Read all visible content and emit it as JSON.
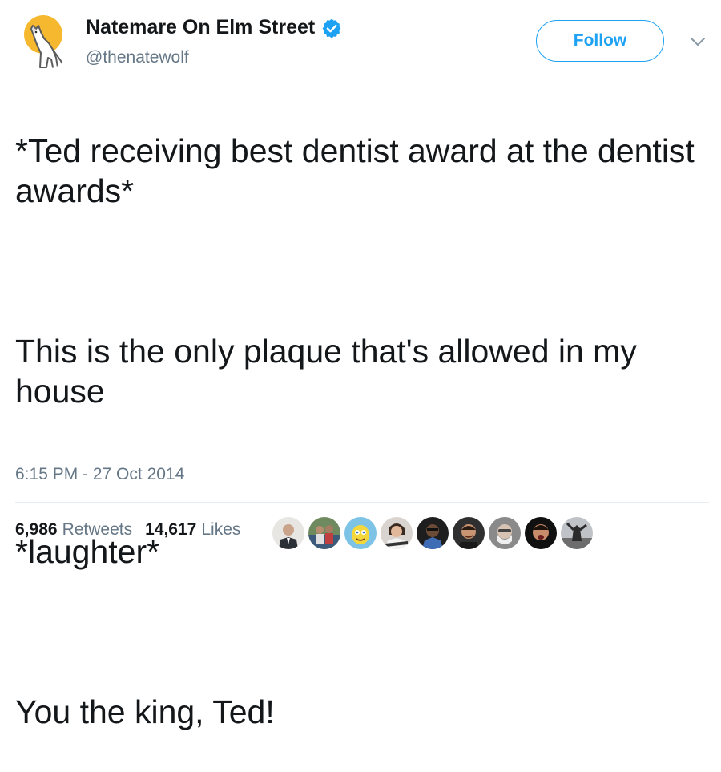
{
  "user": {
    "display_name": "Natemare On Elm Street",
    "handle": "@thenatewolf",
    "avatar_icon": "howling-wolf-moon-icon",
    "verified_icon": "verified-badge-icon",
    "verified_color": "#1da1f2"
  },
  "actions": {
    "follow_label": "Follow",
    "more_icon": "chevron-down-icon"
  },
  "tweet": {
    "paragraphs": [
      "*Ted receiving best dentist award at the dentist awards*",
      "This is the only plaque that's allowed in my house",
      "*laughter*",
      "You the king, Ted!"
    ],
    "timestamp": "6:15 PM - 27 Oct 2014"
  },
  "stats": {
    "retweets_count": "6,986",
    "retweets_label": "Retweets",
    "likes_count": "14,617",
    "likes_label": "Likes"
  },
  "likers": [
    {
      "icon": "liker-avatar-1"
    },
    {
      "icon": "liker-avatar-2"
    },
    {
      "icon": "liker-avatar-3"
    },
    {
      "icon": "liker-avatar-4"
    },
    {
      "icon": "liker-avatar-5"
    },
    {
      "icon": "liker-avatar-6"
    },
    {
      "icon": "liker-avatar-7"
    },
    {
      "icon": "liker-avatar-8"
    },
    {
      "icon": "liker-avatar-9"
    }
  ],
  "colors": {
    "accent": "#1da1f2",
    "text": "#14171a",
    "secondary_text": "#657786",
    "divider": "#e6ecf0"
  }
}
